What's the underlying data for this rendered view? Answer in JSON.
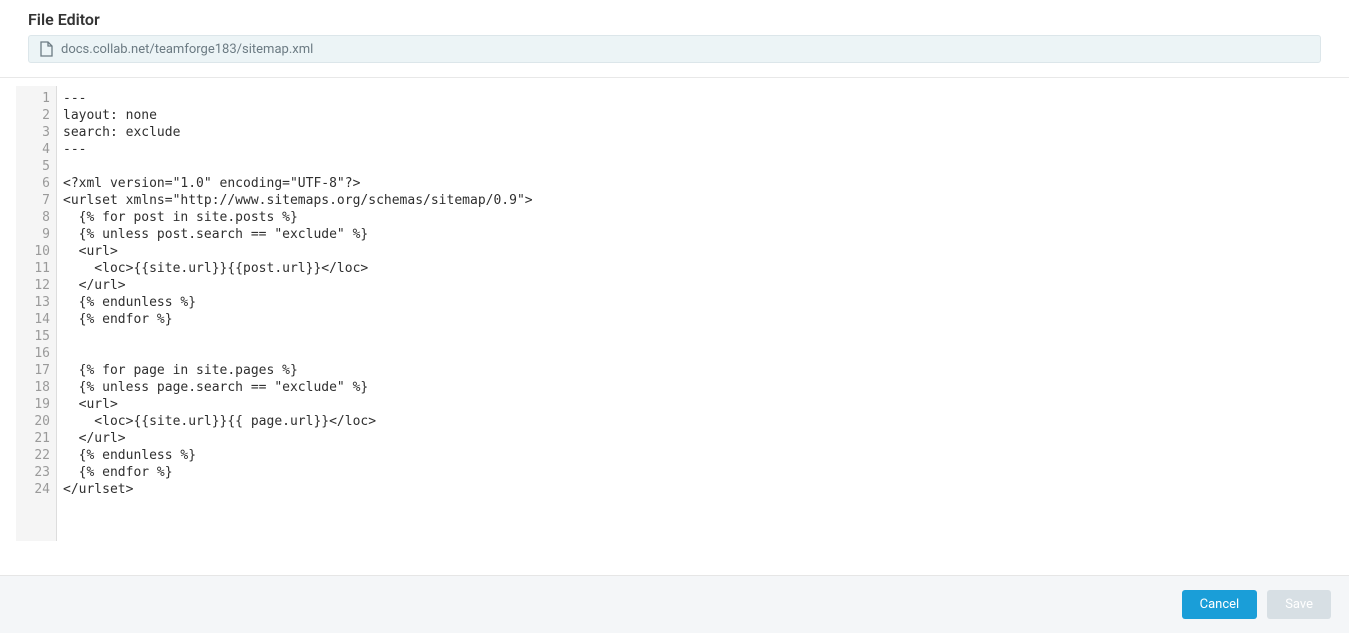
{
  "header": {
    "title": "File Editor",
    "file_path": "docs.collab.net/teamforge183/sitemap.xml"
  },
  "editor": {
    "lines": [
      "---",
      "layout: none",
      "search: exclude",
      "---",
      "",
      "<?xml version=\"1.0\" encoding=\"UTF-8\"?>",
      "<urlset xmlns=\"http://www.sitemaps.org/schemas/sitemap/0.9\">",
      "  {% for post in site.posts %}",
      "  {% unless post.search == \"exclude\" %}",
      "  <url>",
      "    <loc>{{site.url}}{{post.url}}</loc>",
      "  </url>",
      "  {% endunless %}",
      "  {% endfor %}",
      "",
      "",
      "  {% for page in site.pages %}",
      "  {% unless page.search == \"exclude\" %}",
      "  <url>",
      "    <loc>{{site.url}}{{ page.url}}</loc>",
      "  </url>",
      "  {% endunless %}",
      "  {% endfor %}",
      "</urlset>"
    ]
  },
  "footer": {
    "cancel_label": "Cancel",
    "save_label": "Save"
  }
}
